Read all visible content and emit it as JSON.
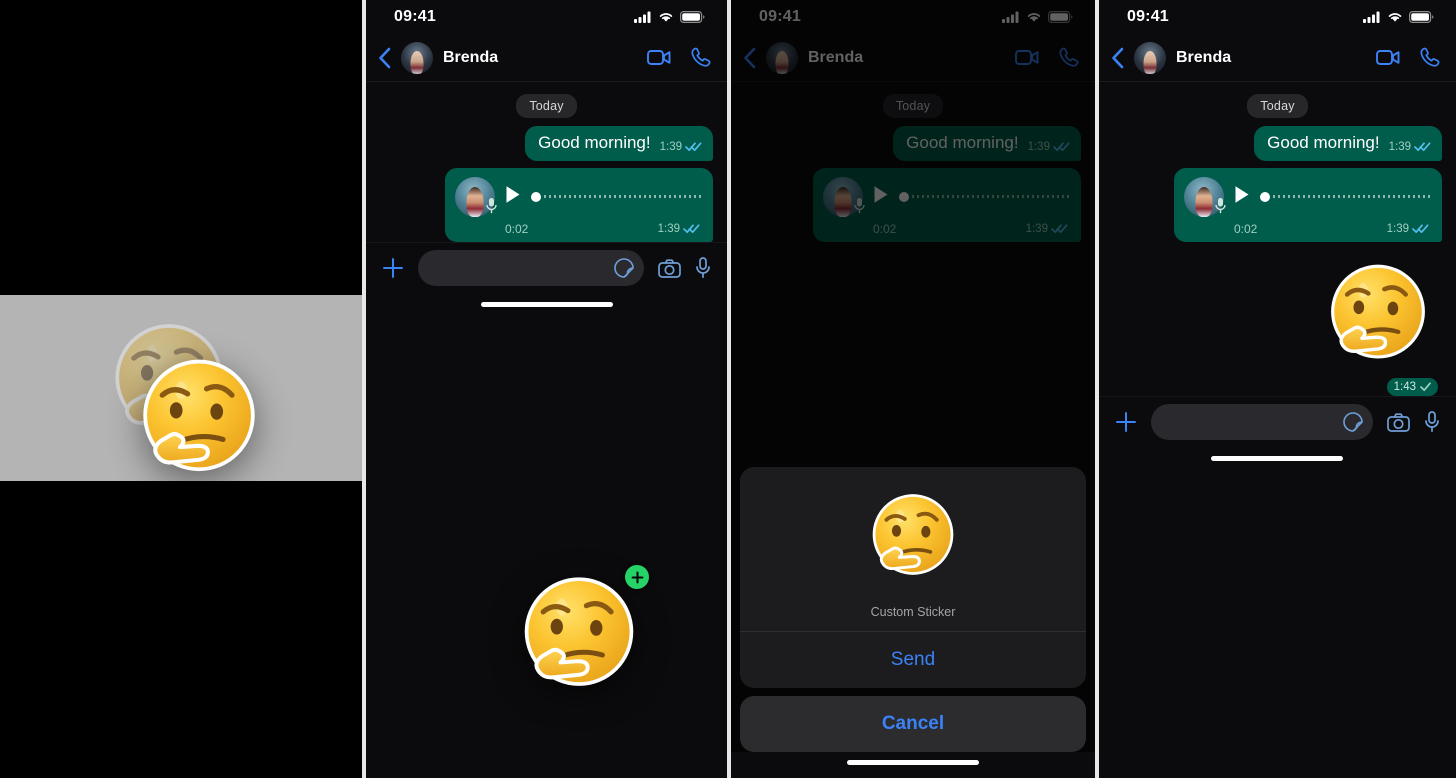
{
  "panels": [
    {
      "id": "sticker-lift-preview",
      "kind": "drag-preview",
      "background": "#000000",
      "band_color": "#b4b4b4",
      "sticker_label": "thinking-face-emoji"
    },
    {
      "id": "chat-drag",
      "kind": "chat",
      "status": {
        "time": "09:41",
        "signal": "cellular-bars-icon",
        "wifi": "wifi-icon",
        "battery": "battery-icon"
      },
      "header": {
        "back": "back-chevron-icon",
        "avatar": "brenda-avatar",
        "name": "Brenda",
        "video": "video-call-icon",
        "call": "voice-call-icon"
      },
      "day_divider": "Today",
      "messages": [
        {
          "type": "text",
          "text": "Good morning!",
          "time": "1:39",
          "status": "read"
        },
        {
          "type": "voice",
          "duration": "0:02",
          "time": "1:39",
          "status": "read"
        }
      ],
      "drag": {
        "sticker_label": "thinking-face-emoji",
        "badge": "add-plus-icon",
        "badge_color": "#25d366"
      },
      "input": {
        "plus": "plus-icon",
        "value": "",
        "placeholder": "",
        "sticker": "sticker-icon",
        "camera": "camera-icon",
        "mic": "microphone-icon"
      }
    },
    {
      "id": "chat-action-sheet",
      "kind": "chat-sheet",
      "status": {
        "time": "09:41",
        "signal": "cellular-bars-icon",
        "wifi": "wifi-icon",
        "battery": "battery-icon"
      },
      "header": {
        "back": "back-chevron-icon",
        "avatar": "brenda-avatar",
        "name": "Brenda",
        "video": "video-call-icon",
        "call": "voice-call-icon"
      },
      "day_divider": "Today",
      "messages": [
        {
          "type": "text",
          "text": "Good morning!",
          "time": "1:39",
          "status": "read"
        },
        {
          "type": "voice",
          "duration": "0:02",
          "time": "1:39",
          "status": "read"
        }
      ],
      "sheet": {
        "preview_label": "thinking-face-emoji",
        "caption": "Custom Sticker",
        "send_label": "Send",
        "cancel_label": "Cancel",
        "accent": "#3b82f6"
      }
    },
    {
      "id": "chat-sticker-sent",
      "kind": "chat",
      "status": {
        "time": "09:41",
        "signal": "cellular-bars-icon",
        "wifi": "wifi-icon",
        "battery": "battery-icon"
      },
      "header": {
        "back": "back-chevron-icon",
        "avatar": "brenda-avatar",
        "name": "Brenda",
        "video": "video-call-icon",
        "call": "voice-call-icon"
      },
      "day_divider": "Today",
      "messages": [
        {
          "type": "text",
          "text": "Good morning!",
          "time": "1:39",
          "status": "read"
        },
        {
          "type": "voice",
          "duration": "0:02",
          "time": "1:39",
          "status": "read"
        },
        {
          "type": "sticker",
          "label": "thinking-face-emoji",
          "time": "1:43",
          "status": "sent"
        }
      ],
      "input": {
        "plus": "plus-icon",
        "value": "",
        "placeholder": "",
        "sticker": "sticker-icon",
        "camera": "camera-icon",
        "mic": "microphone-icon"
      }
    }
  ],
  "colors": {
    "bubble_green": "#005c4b",
    "accent_blue": "#3b82f6",
    "tick_blue": "#53bdeb",
    "badge_green": "#25d366",
    "chat_bg": "#0b0b0d"
  }
}
